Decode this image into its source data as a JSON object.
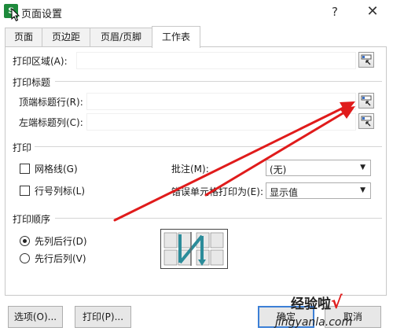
{
  "window": {
    "title": "页面设置",
    "app_icon": "S",
    "help_label": "?",
    "close_label": "✕"
  },
  "tabs": [
    {
      "label": "页面"
    },
    {
      "label": "页边距"
    },
    {
      "label": "页眉/页脚"
    },
    {
      "label": "工作表",
      "active": true
    }
  ],
  "print_area": {
    "label": "打印区域(A):",
    "value": ""
  },
  "print_titles": {
    "group_label": "打印标题",
    "top_rows": {
      "label": "顶端标题行(R):",
      "value": ""
    },
    "left_cols": {
      "label": "左端标题列(C):",
      "value": ""
    }
  },
  "print": {
    "group_label": "打印",
    "gridlines": {
      "label": "网格线(G)",
      "checked": false
    },
    "row_col_headers": {
      "label": "行号列标(L)",
      "checked": false
    },
    "comments": {
      "label": "批注(M):",
      "selected": "(无)"
    },
    "errors": {
      "label": "错误单元格打印为(E):",
      "selected": "显示值"
    }
  },
  "page_order": {
    "group_label": "打印顺序",
    "down_then_over": {
      "label": "先列后行(D)",
      "checked": true
    },
    "over_then_down": {
      "label": "先行后列(V)",
      "checked": false
    }
  },
  "buttons": {
    "options": "选项(O)...",
    "print": "打印(P)...",
    "ok": "确定",
    "cancel": "取消"
  },
  "watermark": {
    "text": "经验啦",
    "check": "√",
    "url": "jingyanla.com"
  },
  "colors": {
    "accent": "#3c7fd6",
    "annotation_arrow": "#e01b1b",
    "app_icon": "#1e8a3c"
  }
}
